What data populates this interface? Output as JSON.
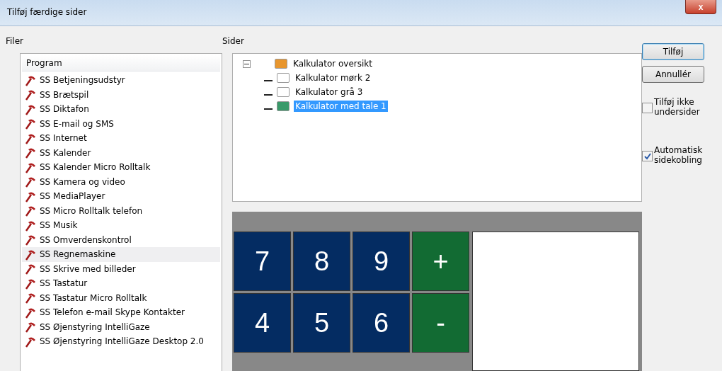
{
  "window": {
    "title": "Tilføj færdige sider",
    "close": "x"
  },
  "files": {
    "label": "Filer",
    "column": "Program",
    "items": [
      {
        "name": "SS Betjeningsudstyr",
        "selected": false
      },
      {
        "name": "SS Brætspil",
        "selected": false
      },
      {
        "name": "SS Diktafon",
        "selected": false
      },
      {
        "name": "SS E-mail og SMS",
        "selected": false
      },
      {
        "name": "SS Internet",
        "selected": false
      },
      {
        "name": "SS Kalender",
        "selected": false
      },
      {
        "name": "SS Kalender Micro Rolltalk",
        "selected": false
      },
      {
        "name": "SS Kamera og video",
        "selected": false
      },
      {
        "name": "SS MediaPlayer",
        "selected": false
      },
      {
        "name": "SS Micro Rolltalk telefon",
        "selected": false
      },
      {
        "name": "SS Musik",
        "selected": false
      },
      {
        "name": "SS Omverdenskontrol",
        "selected": false
      },
      {
        "name": "SS Regnemaskine",
        "selected": true
      },
      {
        "name": "SS Skrive med billeder",
        "selected": false
      },
      {
        "name": "SS Tastatur",
        "selected": false
      },
      {
        "name": "SS Tastatur Micro Rolltalk",
        "selected": false
      },
      {
        "name": "SS Telefon e-mail Skype Kontakter",
        "selected": false
      },
      {
        "name": "SS Øjenstyring IntelliGaze",
        "selected": false
      },
      {
        "name": "SS Øjenstyring IntelliGaze Desktop 2.0",
        "selected": false
      }
    ]
  },
  "pages": {
    "label": "Sider",
    "tree": [
      {
        "label": "Kalkulator oversikt",
        "color": "#e8962e",
        "selected": false,
        "expanded": true,
        "children": [
          {
            "label": "Kalkulator mørk 2",
            "color": "#ffffff",
            "selected": false
          },
          {
            "label": "Kalkulator grå 3",
            "color": "#ffffff",
            "selected": false
          },
          {
            "label": "Kalkulator med tale 1",
            "color": "#3a9a6a",
            "selected": true
          }
        ]
      }
    ]
  },
  "preview": {
    "keys": [
      {
        "label": "7",
        "kind": "digit"
      },
      {
        "label": "8",
        "kind": "digit"
      },
      {
        "label": "9",
        "kind": "digit"
      },
      {
        "label": "+",
        "kind": "operator"
      },
      {
        "label": "4",
        "kind": "digit"
      },
      {
        "label": "5",
        "kind": "digit"
      },
      {
        "label": "6",
        "kind": "digit"
      },
      {
        "label": "-",
        "kind": "operator"
      }
    ]
  },
  "buttons": [
    {
      "label": "Tilføj",
      "focused": true
    },
    {
      "label": "Annullér",
      "focused": false
    }
  ],
  "options": [
    {
      "label": "Tilføj ikke undersider",
      "checked": false
    },
    {
      "label": "Automatisk sidekobling",
      "checked": true
    }
  ]
}
